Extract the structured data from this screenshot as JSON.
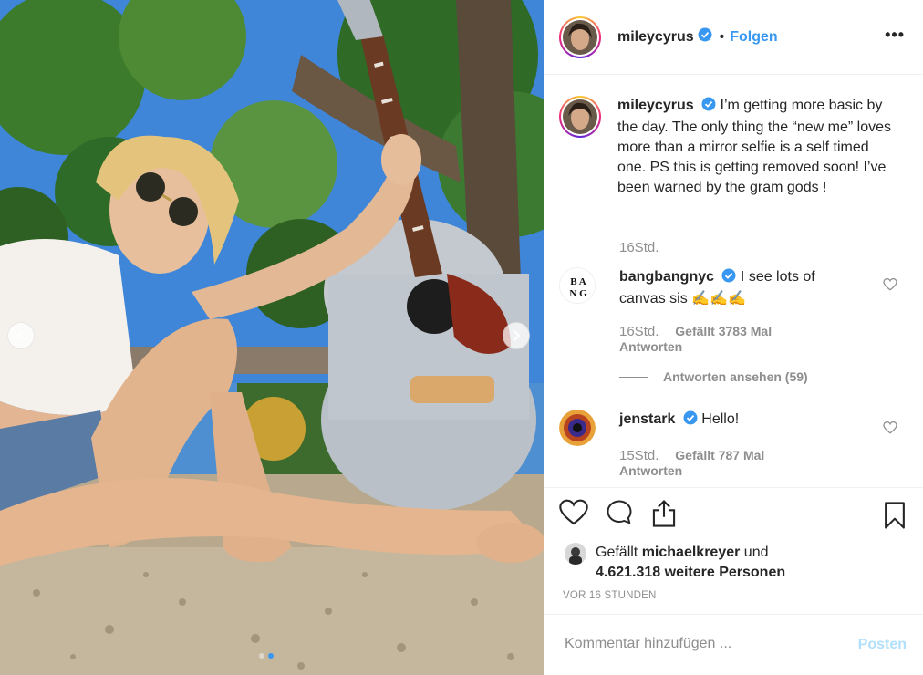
{
  "post": {
    "author": "mileycyrus",
    "separator": "•",
    "follow_label": "Folgen",
    "more_label": "•••",
    "caption": "I’m getting more basic by the day. The only thing the “new me” loves more than a mirror selfie is a self timed one. PS this is getting removed soon! I’ve been warned by the gram gods !",
    "caption_time": "16Std."
  },
  "comments": [
    {
      "user": "bangbangnyc",
      "avatar_text": "BA\nNG",
      "text": "I see lots of canvas sis",
      "emoji": "✍✍✍",
      "time": "16Std.",
      "likes": "Gefällt 3783 Mal",
      "reply_label": "Antworten",
      "view_replies": "Antworten ansehen (59)"
    },
    {
      "user": "jenstark",
      "text": "Hello!",
      "time": "15Std.",
      "likes": "Gefällt 787 Mal",
      "reply_label": "Antworten"
    }
  ],
  "likes_line": {
    "prefix": "Gefällt",
    "liked_user": "michaelkreyer",
    "connector": "und",
    "count_text": "4.621.318 weitere Personen"
  },
  "posted_ago": "VOR 16 STUNDEN",
  "comment_box": {
    "placeholder": "Kommentar hinzufügen ...",
    "post_label": "Posten"
  },
  "colors": {
    "accent": "#3897f0",
    "post_disabled": "#b2dffc",
    "verified": "#3897f0"
  },
  "icons": {
    "like": "heart-icon",
    "comment": "comment-icon",
    "share": "share-icon",
    "save": "bookmark-icon",
    "prev": "chevron-left-icon",
    "next": "chevron-right-icon",
    "verified": "verified-badge-icon"
  },
  "carousel": {
    "slides": 2,
    "active": 1
  }
}
